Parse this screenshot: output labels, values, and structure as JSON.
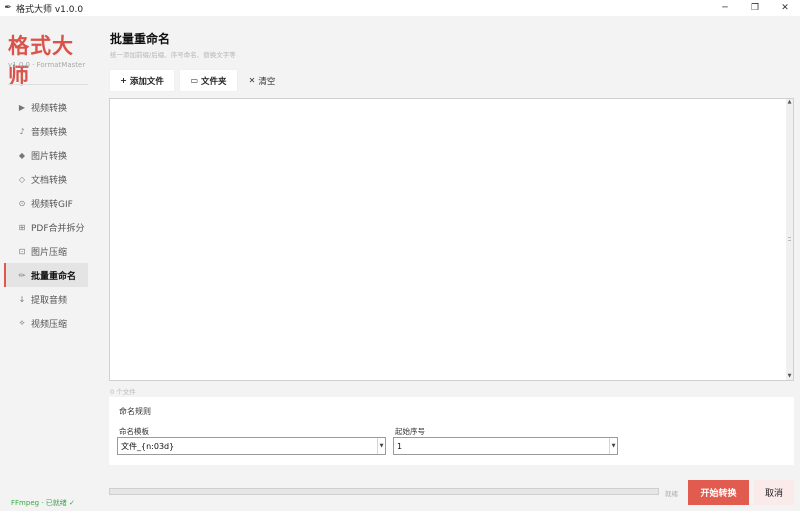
{
  "window": {
    "title": "格式大师 v1.0.0",
    "minimize_glyph": "─",
    "maximize_glyph": "❐",
    "close_glyph": "✕",
    "app_icon_glyph": "✒"
  },
  "sidebar": {
    "brand": "格式大师",
    "version": "v1.0.0 · FormatMaster",
    "items": [
      {
        "icon": "play-icon",
        "glyph": "▶",
        "label": "视频转换",
        "active": false
      },
      {
        "icon": "music-note-icon",
        "glyph": "♪",
        "label": "音频转换",
        "active": false
      },
      {
        "icon": "diamond-icon",
        "glyph": "◆",
        "label": "图片转换",
        "active": false
      },
      {
        "icon": "diamond-outline-icon",
        "glyph": "◇",
        "label": "文档转换",
        "active": false
      },
      {
        "icon": "circle-icon",
        "glyph": "⊙",
        "label": "视频转GIF",
        "active": false
      },
      {
        "icon": "grid-icon",
        "glyph": "⊞",
        "label": "PDF合并拆分",
        "active": false
      },
      {
        "icon": "square-icon",
        "glyph": "⊡",
        "label": "图片压缩",
        "active": false
      },
      {
        "icon": "pencil-icon",
        "glyph": "✏",
        "label": "批量重命名",
        "active": true
      },
      {
        "icon": "down-arrow-icon",
        "glyph": "↓",
        "label": "提取音频",
        "active": false
      },
      {
        "icon": "compress-icon",
        "glyph": "⟡",
        "label": "视频压缩",
        "active": false
      }
    ],
    "ffmpeg_status": "FFmpeg · 已就绪 ✓"
  },
  "main": {
    "title": "批量重命名",
    "subtitle": "统一添加前缀/后缀、序号命名、替换文字等",
    "toolbar": {
      "add_file_glyph": "+",
      "add_file": "添加文件",
      "folder_glyph": "▭",
      "folder": "文件夹",
      "clear_glyph": "✕",
      "clear": "清空"
    },
    "file_count": "0 个文件",
    "rules": {
      "title": "命名规则",
      "template_label": "命名模板",
      "template_value": "文件_{n:03d}",
      "start_label": "起始序号",
      "start_value": "1",
      "dropdown_glyph": "▼"
    },
    "scroll_up_glyph": "▲",
    "scroll_down_glyph": "▼",
    "status": "就绪",
    "start_button": "开始转换",
    "cancel_button": "取消"
  },
  "colors": {
    "accent": "#e15b4f",
    "brand": "#d9534a",
    "ok": "#3aa647"
  }
}
